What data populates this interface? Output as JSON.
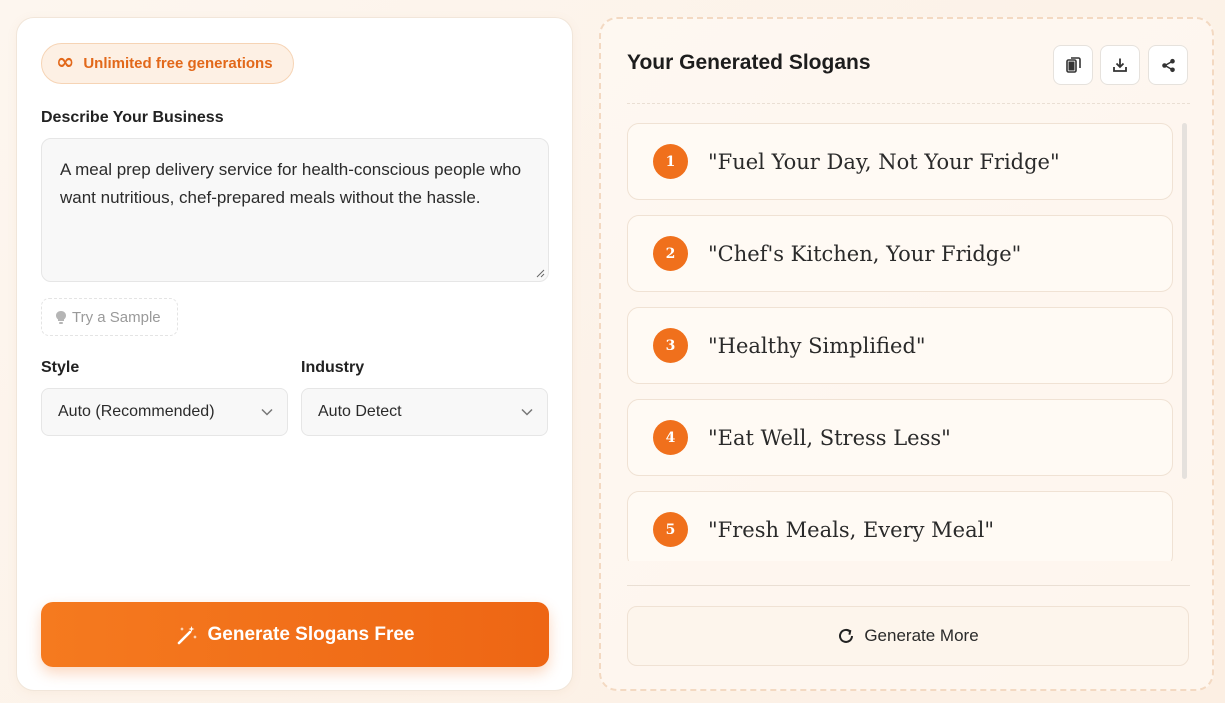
{
  "badge": {
    "label": "Unlimited free generations",
    "icon": "infinity-icon"
  },
  "form": {
    "description_label": "Describe Your Business",
    "description_value": "A meal prep delivery service for health-conscious people who want nutritious, chef-prepared meals without the hassle.",
    "sample_button": "Try a Sample",
    "style_label": "Style",
    "style_value": "Auto (Recommended)",
    "industry_label": "Industry",
    "industry_value": "Auto Detect",
    "generate_button": "Generate Slogans Free"
  },
  "results": {
    "title": "Your Generated Slogans",
    "actions": [
      "copy-icon",
      "download-icon",
      "share-icon"
    ],
    "slogans": [
      {
        "num": "1",
        "text": "\"Fuel Your Day, Not Your Fridge\""
      },
      {
        "num": "2",
        "text": "\"Chef's Kitchen, Your Fridge\""
      },
      {
        "num": "3",
        "text": "\"Healthy Simplified\""
      },
      {
        "num": "4",
        "text": "\"Eat Well, Stress Less\""
      },
      {
        "num": "5",
        "text": "\"Fresh Meals, Every Meal\""
      }
    ],
    "more_button": "Generate More"
  },
  "colors": {
    "accent": "#f0701c",
    "badge_text": "#e2681a"
  }
}
